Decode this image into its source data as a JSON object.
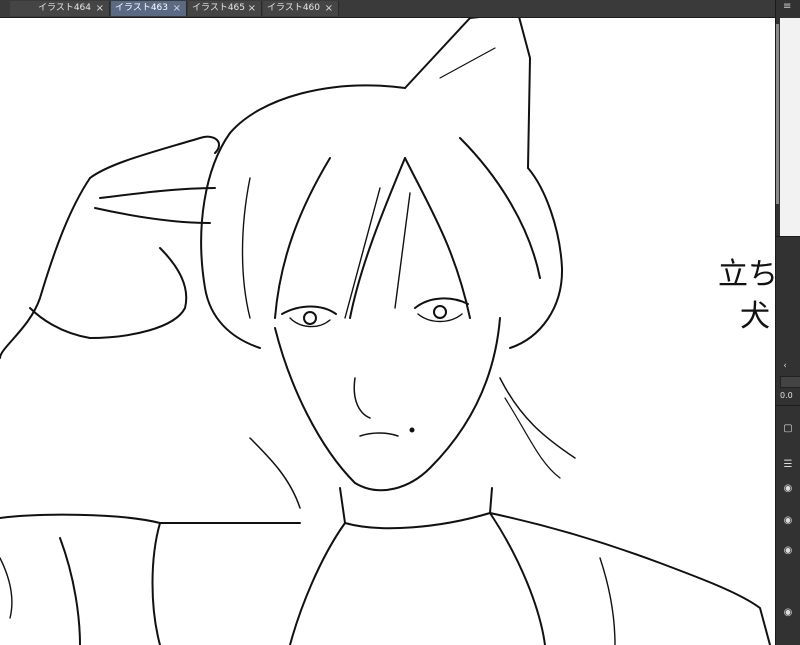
{
  "tabs": [
    {
      "label": "イラスト464",
      "active": false
    },
    {
      "label": "イラスト463",
      "active": true
    },
    {
      "label": "イラスト465",
      "active": false
    },
    {
      "label": "イラスト460",
      "active": false
    }
  ],
  "tab_close_glyph": "×",
  "menu_glyph": "≡",
  "canvas": {
    "handwritten_note_line1": "立ち",
    "handwritten_note_line2": "犬"
  },
  "panel": {
    "readout": "0.0",
    "scroll_glyph": "‹",
    "icons": [
      "eye-icon",
      "eye-icon",
      "eye-icon",
      "eye-icon"
    ]
  },
  "colors": {
    "active_tab": "#5a6a85",
    "ui_dark": "#323232",
    "canvas": "#ffffff"
  }
}
